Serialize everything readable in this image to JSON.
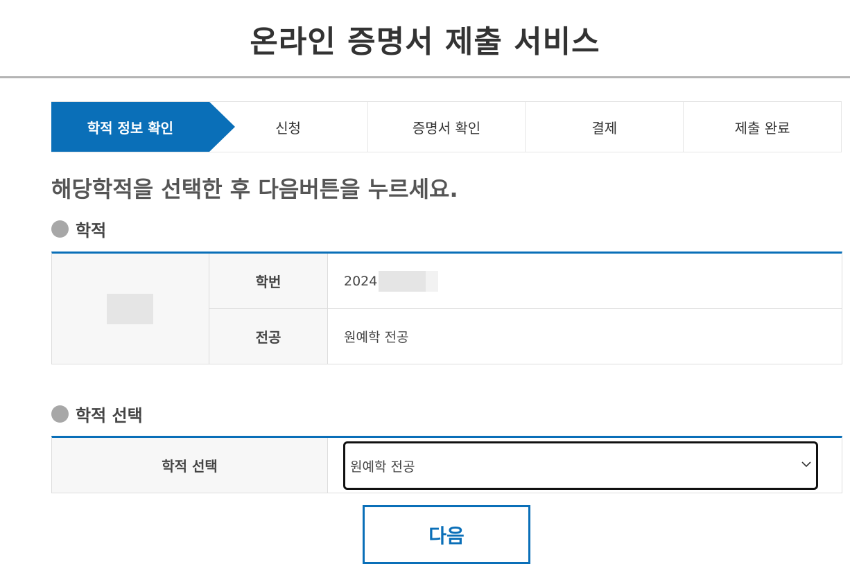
{
  "header": {
    "title": "온라인 증명서 제출 서비스"
  },
  "steps": [
    {
      "label": "학적 정보 확인",
      "active": true
    },
    {
      "label": "신청",
      "active": false
    },
    {
      "label": "증명서 확인",
      "active": false
    },
    {
      "label": "결제",
      "active": false
    },
    {
      "label": "제출 완료",
      "active": false
    }
  ],
  "instruction": "해당학적을 선택한 후 다음버튼을 누르세요.",
  "academic_section": {
    "title": "학적",
    "rows": [
      {
        "label": "학번",
        "value": "2024"
      },
      {
        "label": "전공",
        "value": "원예학 전공"
      }
    ]
  },
  "select_section": {
    "title": "학적 선택",
    "label": "학적 선택",
    "selected_value": "원예학 전공"
  },
  "next_button": {
    "label": "다음"
  },
  "colors": {
    "accent": "#0a6fb8",
    "bullet": "#a7a7a7",
    "label_bg": "#f7f7f7"
  }
}
